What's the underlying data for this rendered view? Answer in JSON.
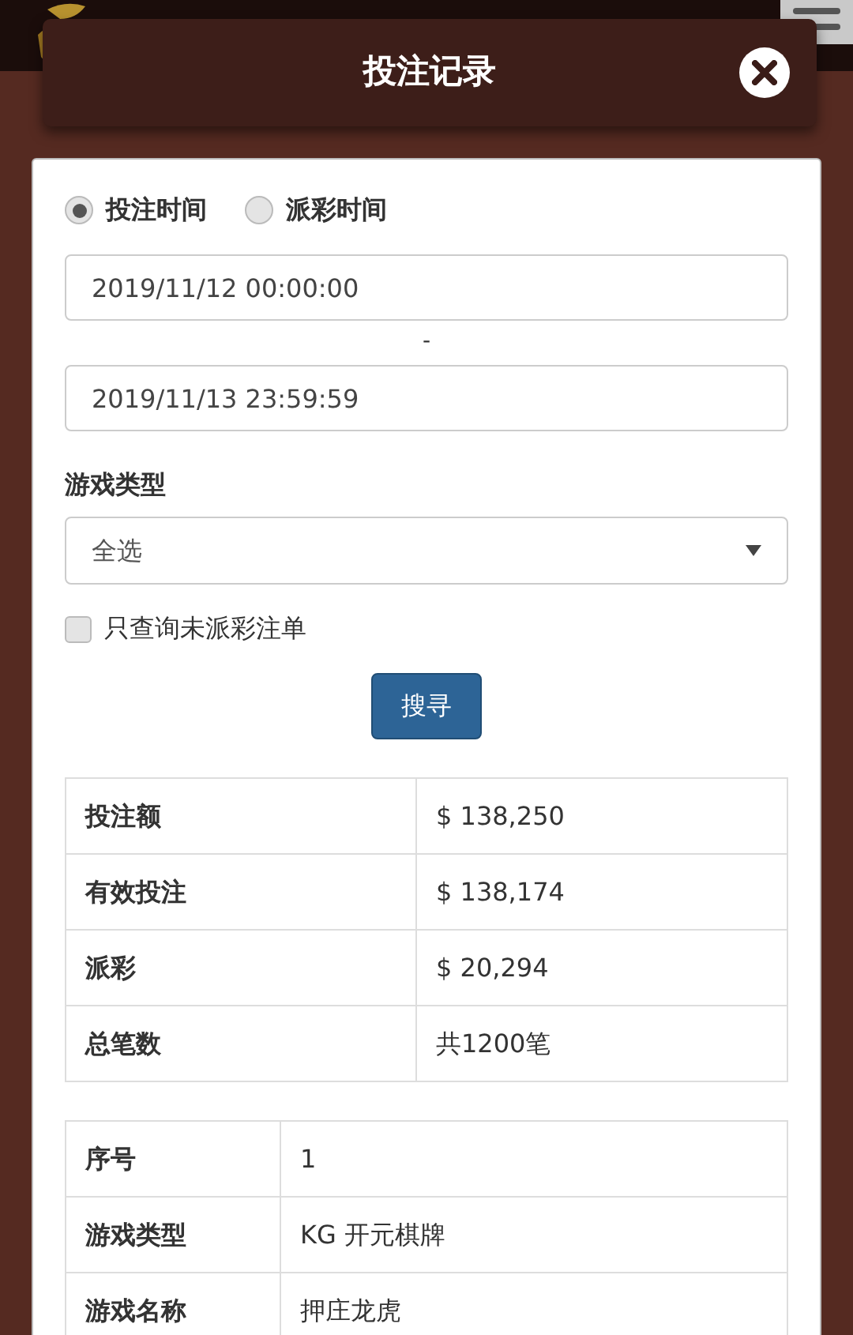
{
  "title": "投注记录",
  "time_options": [
    {
      "label": "投注时间",
      "selected": true
    },
    {
      "label": "派彩时间",
      "selected": false
    }
  ],
  "start_time": "2019/11/12 00:00:00",
  "separator": "-",
  "end_time": "2019/11/13 23:59:59",
  "game_type": {
    "label": "游戏类型",
    "value": "全选"
  },
  "unsettled_only": {
    "label": "只查询未派彩注单",
    "checked": false
  },
  "search_button": "搜寻",
  "summary": [
    {
      "label": "投注额",
      "value": "$ 138,250"
    },
    {
      "label": "有效投注",
      "value": "$ 138,174"
    },
    {
      "label": "派彩",
      "value": "$ 20,294"
    },
    {
      "label": "总笔数",
      "value": "共1200笔"
    }
  ],
  "records": [
    [
      {
        "label": "序号",
        "value": "1"
      },
      {
        "label": "游戏类型",
        "value": "KG 开元棋牌"
      },
      {
        "label": "游戏名称",
        "value": "押庄龙虎"
      }
    ]
  ]
}
